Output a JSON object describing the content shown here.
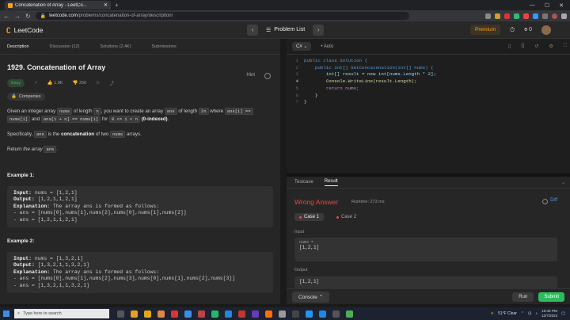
{
  "browser": {
    "tab_title": "Concatenation of Array - LeetCo...",
    "url_host": "leetcode.com",
    "url_path": "/problems/concatenation-of-array/description/"
  },
  "nav": {
    "logo": "LeetCode",
    "problem_list": "Problem List",
    "premium": "Premium",
    "streak_count": "0"
  },
  "left_tabs": [
    "Description",
    "Discussion (12)",
    "Solutions (2.4K)",
    "Submissions"
  ],
  "problem": {
    "title": "1929. Concatenation of Array",
    "hint": "Hint",
    "difficulty": "Easy",
    "likes": "1.8K",
    "dislikes": "256",
    "companies": "Companies",
    "desc": {
      "t1": "Given an integer array ",
      "c1": "nums",
      "t2": " of length ",
      "c2": "n",
      "t3": ", you want to create an array ",
      "c3": "ans",
      "t4": " of length ",
      "c4": "2n",
      "t5": " where ",
      "c5": "ans[i] ==",
      "c6": "nums[i]",
      "t6": " and ",
      "c7": "ans[i + n] == nums[i]",
      "t7": " for ",
      "c8": "0 <= i < n",
      "b1": "(0-indexed)",
      "t8": "."
    },
    "specifically": {
      "t1": "Specifically, ",
      "c1": "ans",
      "t2": " is the ",
      "b1": "concatenation",
      "t3": " of two ",
      "c2": "nums",
      "t4": " arrays."
    },
    "ret": {
      "t1": "Return ",
      "i1": "the array",
      "c1": "ans",
      "t2": "."
    },
    "examples": [
      {
        "heading": "Example 1:",
        "input": " nums = [1,2,1]",
        "output": " [1,2,1,1,2,1]",
        "explanation": " The array ans is formed as follows:",
        "lines": [
          "- ans = [nums[0],nums[1],nums[2],nums[0],nums[1],nums[2]]",
          "- ans = [1,2,1,1,2,1]"
        ]
      },
      {
        "heading": "Example 2:",
        "input": " nums = [1,3,2,1]",
        "output": " [1,3,2,1,1,3,2,1]",
        "explanation": " The array ans is formed as follows:",
        "lines": [
          "- ans = [nums[0],nums[1],nums[2],nums[3],nums[0],nums[1],nums[2],nums[3]]",
          "- ans = [1,3,2,1,1,3,2,1]"
        ]
      }
    ],
    "labels": {
      "input": "Input:",
      "output": "Output:",
      "explanation": "Explanation:"
    }
  },
  "editor": {
    "language": "C#",
    "mode": "Auto",
    "line_numbers": [
      "1",
      "2",
      "3",
      "4",
      "5",
      "6",
      "7"
    ],
    "lines": [
      "public class Solution {",
      "    public int[] GetConcatenation(int[] nums) {",
      "        int[] result = new int[nums.Length * 2];",
      "        Console.WriteLine(result.Length);",
      "        return nums;",
      "    }",
      "}"
    ]
  },
  "result": {
    "tabs": [
      "Testcase",
      "Result"
    ],
    "verdict": "Wrong Answer",
    "runtime": "Runtime: 273 ms",
    "diff": "Diff",
    "cases": [
      "Case 1",
      "Case 2"
    ],
    "input_label": "Input",
    "input_key": "nums =",
    "input_value": "[1,2,1]",
    "output_label": "Output",
    "output_value": "[1,2,1]",
    "console": "Console",
    "run": "Run",
    "submit": "Submit"
  },
  "taskbar": {
    "search": "Type here to search",
    "weather": "51°F  Clear",
    "time": "10:44 PM",
    "date": "12/7/2022"
  },
  "colors": {
    "accent": "#ffa116",
    "easy": "#2cbb5d",
    "wrong": "#ef4743",
    "submit": "#2cbb5d"
  }
}
